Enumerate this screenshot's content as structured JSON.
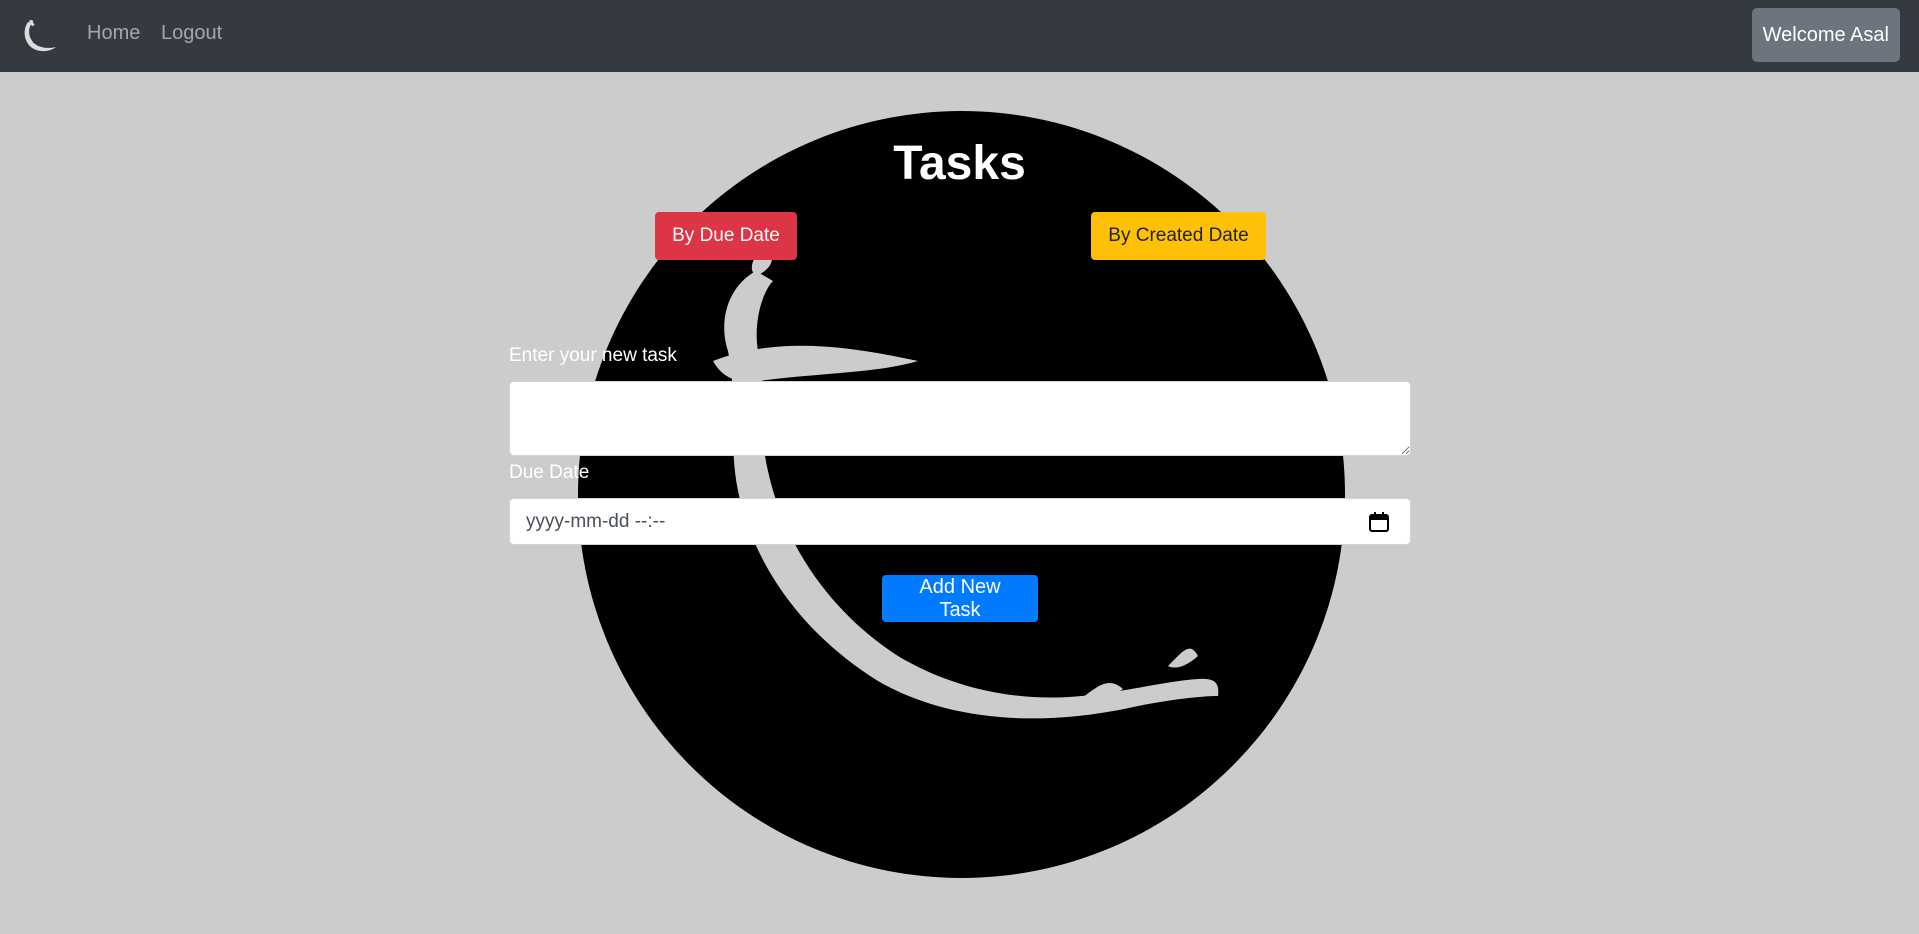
{
  "navbar": {
    "logo_icon": "flask-logo-icon",
    "home_label": "Home",
    "logout_label": "Logout",
    "welcome_label": "Welcome Asal"
  },
  "main": {
    "background_logo_icon": "flask-logo-icon",
    "title": "Tasks",
    "sort_due_label": "By Due Date",
    "sort_created_label": "By Created Date",
    "task_label": "Enter your new task",
    "task_value": "",
    "due_label": "Due Date",
    "due_placeholder": "yyyy-mm-dd --:--",
    "calendar_icon": "calendar-icon",
    "add_label": "Add New Task"
  },
  "colors": {
    "navbar": "#343a40",
    "page_bg": "#cccccc",
    "danger": "#dc3545",
    "warning": "#ffc107",
    "primary": "#007bff",
    "secondary": "#6c757d"
  }
}
